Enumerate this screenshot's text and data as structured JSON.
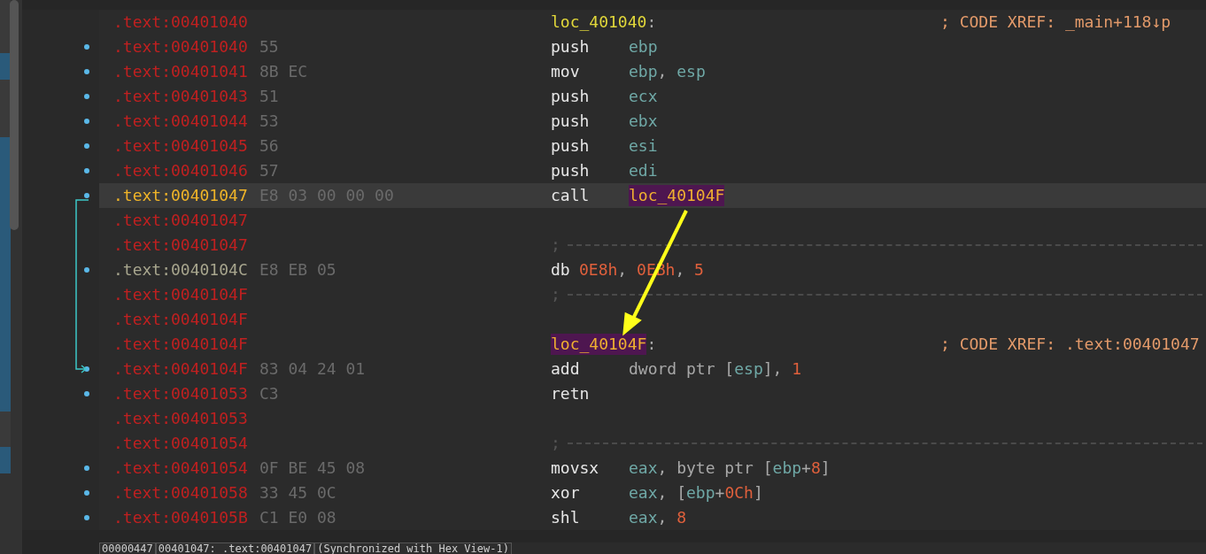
{
  "lines": [
    {
      "address": ".text:00401040",
      "color": "#c02020",
      "bullet": false,
      "current": false,
      "kind": "label",
      "label": "loc_401040",
      "label_highlighted": false,
      "colon": ":",
      "comment": "; CODE XREF: _main+118↓p"
    },
    {
      "address": ".text:00401040",
      "color": "#c02020",
      "bullet": true,
      "current": false,
      "kind": "instruction",
      "bytes": "55",
      "mnemonic": "push",
      "operand_highlighted": false,
      "operands": [
        {
          "text": "ebp",
          "kind": "reg"
        }
      ]
    },
    {
      "address": ".text:00401041",
      "color": "#c02020",
      "bullet": true,
      "current": false,
      "kind": "instruction",
      "bytes": "8B EC",
      "mnemonic": "mov",
      "operand_highlighted": false,
      "operands": [
        {
          "text": "ebp",
          "kind": "reg"
        },
        {
          "text": ", ",
          "kind": "plain"
        },
        {
          "text": "esp",
          "kind": "reg"
        }
      ]
    },
    {
      "address": ".text:00401043",
      "color": "#c02020",
      "bullet": true,
      "current": false,
      "kind": "instruction",
      "bytes": "51",
      "mnemonic": "push",
      "operand_highlighted": false,
      "operands": [
        {
          "text": "ecx",
          "kind": "reg"
        }
      ]
    },
    {
      "address": ".text:00401044",
      "color": "#c02020",
      "bullet": true,
      "current": false,
      "kind": "instruction",
      "bytes": "53",
      "mnemonic": "push",
      "operand_highlighted": false,
      "operands": [
        {
          "text": "ebx",
          "kind": "reg"
        }
      ]
    },
    {
      "address": ".text:00401045",
      "color": "#c02020",
      "bullet": true,
      "current": false,
      "kind": "instruction",
      "bytes": "56",
      "mnemonic": "push",
      "operand_highlighted": false,
      "operands": [
        {
          "text": "esi",
          "kind": "reg"
        }
      ]
    },
    {
      "address": ".text:00401046",
      "color": "#c02020",
      "bullet": true,
      "current": false,
      "kind": "instruction",
      "bytes": "57",
      "mnemonic": "push",
      "operand_highlighted": false,
      "operands": [
        {
          "text": "edi",
          "kind": "reg"
        }
      ]
    },
    {
      "address": ".text:00401047",
      "color": "#f0b428",
      "bullet": true,
      "current": true,
      "kind": "instruction",
      "bytes": "E8 03 00 00 00",
      "mnemonic": "call",
      "operand_highlighted": true,
      "operands": [
        {
          "text": "loc_40104F",
          "kind": "sym"
        }
      ]
    },
    {
      "address": ".text:00401047",
      "color": "#c02020",
      "bullet": false,
      "current": false,
      "kind": "blank"
    },
    {
      "address": ".text:00401047",
      "color": "#c02020",
      "bullet": false,
      "current": false,
      "kind": "separator",
      "text": ";"
    },
    {
      "address": ".text:0040104C",
      "color": "#a8a68e",
      "bullet": true,
      "current": false,
      "kind": "directive",
      "bytes": "E8 EB 05",
      "mnemonic": "db",
      "operand_highlighted": false,
      "operands": [
        {
          "text": "0E8h",
          "kind": "num"
        },
        {
          "text": ", ",
          "kind": "plain"
        },
        {
          "text": "0EBh",
          "kind": "num"
        },
        {
          "text": ", ",
          "kind": "plain"
        },
        {
          "text": "5",
          "kind": "num"
        }
      ]
    },
    {
      "address": ".text:0040104F",
      "color": "#c02020",
      "bullet": false,
      "current": false,
      "kind": "separator",
      "text": ";"
    },
    {
      "address": ".text:0040104F",
      "color": "#c02020",
      "bullet": false,
      "current": false,
      "kind": "blank"
    },
    {
      "address": ".text:0040104F",
      "color": "#c02020",
      "bullet": false,
      "current": false,
      "kind": "label",
      "label": "loc_40104F",
      "label_highlighted": true,
      "colon": ":",
      "comment": "; CODE XREF: .text:00401047"
    },
    {
      "address": ".text:0040104F",
      "color": "#c02020",
      "bullet": true,
      "current": false,
      "kind": "instruction",
      "bytes": "83 04 24 01",
      "mnemonic": "add",
      "operand_highlighted": false,
      "operands": [
        {
          "text": "dword ptr [",
          "kind": "plain"
        },
        {
          "text": "esp",
          "kind": "reg"
        },
        {
          "text": "], ",
          "kind": "plain"
        },
        {
          "text": "1",
          "kind": "num"
        }
      ]
    },
    {
      "address": ".text:00401053",
      "color": "#c02020",
      "bullet": true,
      "current": false,
      "kind": "instruction",
      "bytes": "C3",
      "mnemonic": "retn"
    },
    {
      "address": ".text:00401053",
      "color": "#c02020",
      "bullet": false,
      "current": false,
      "kind": "blank"
    },
    {
      "address": ".text:00401054",
      "color": "#c02020",
      "bullet": false,
      "current": false,
      "kind": "separator",
      "text": ";"
    },
    {
      "address": ".text:00401054",
      "color": "#c02020",
      "bullet": true,
      "current": false,
      "kind": "instruction",
      "bytes": "0F BE 45 08",
      "mnemonic": "movsx",
      "operand_highlighted": false,
      "operands": [
        {
          "text": "eax",
          "kind": "reg"
        },
        {
          "text": ", byte ptr [",
          "kind": "plain"
        },
        {
          "text": "ebp",
          "kind": "reg"
        },
        {
          "text": "+",
          "kind": "plain"
        },
        {
          "text": "8",
          "kind": "num"
        },
        {
          "text": "]",
          "kind": "plain"
        }
      ]
    },
    {
      "address": ".text:00401058",
      "color": "#c02020",
      "bullet": true,
      "current": false,
      "kind": "instruction",
      "bytes": "33 45 0C",
      "mnemonic": "xor",
      "operand_highlighted": false,
      "operands": [
        {
          "text": "eax",
          "kind": "reg"
        },
        {
          "text": ", [",
          "kind": "plain"
        },
        {
          "text": "ebp",
          "kind": "reg"
        },
        {
          "text": "+",
          "kind": "plain"
        },
        {
          "text": "0Ch",
          "kind": "num"
        },
        {
          "text": "]",
          "kind": "plain"
        }
      ]
    },
    {
      "address": ".text:0040105B",
      "color": "#c02020",
      "bullet": true,
      "current": false,
      "kind": "instruction",
      "bytes": "C1 E0 08",
      "mnemonic": "shl",
      "operand_highlighted": false,
      "operands": [
        {
          "text": "eax",
          "kind": "reg"
        },
        {
          "text": ", ",
          "kind": "plain"
        },
        {
          "text": "8",
          "kind": "num"
        }
      ]
    }
  ],
  "status_bar": [
    "00000447",
    "00401047: .text:00401047",
    "(Synchronized with Hex View-1)"
  ]
}
